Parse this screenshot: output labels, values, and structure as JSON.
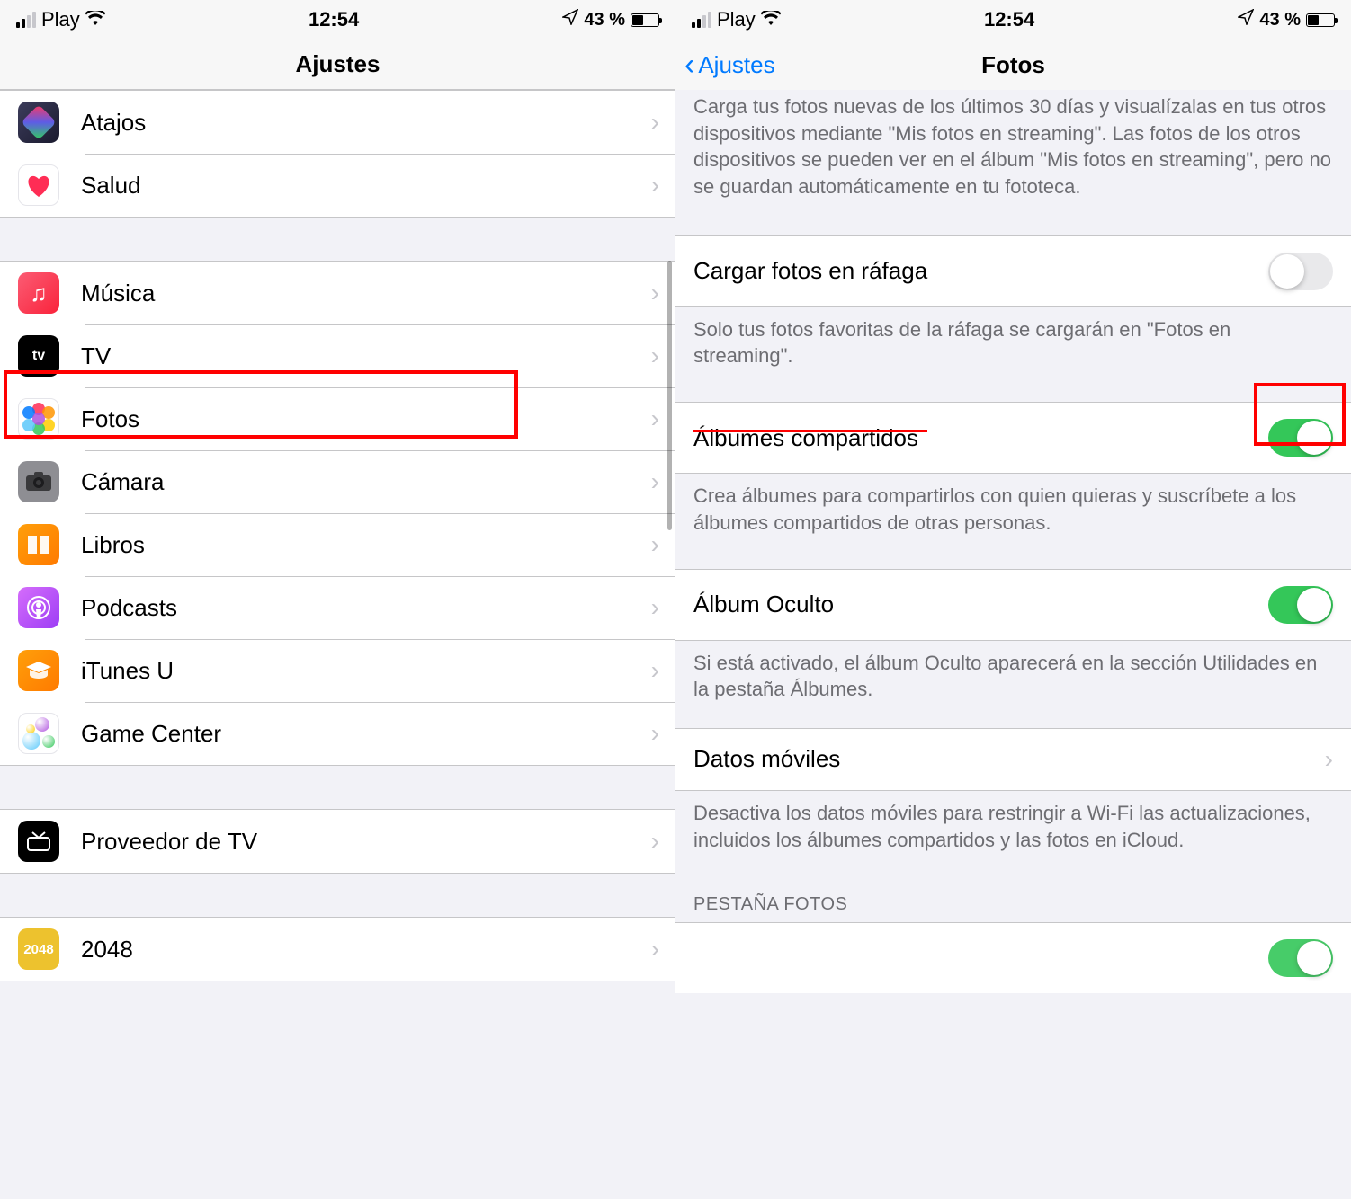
{
  "status": {
    "carrier": "Play",
    "time": "12:54",
    "battery": "43 %"
  },
  "left": {
    "title": "Ajustes",
    "sections": [
      {
        "items": [
          {
            "label": "Atajos",
            "icon": "atajos"
          },
          {
            "label": "Salud",
            "icon": "salud"
          }
        ]
      },
      {
        "items": [
          {
            "label": "Música",
            "icon": "musica"
          },
          {
            "label": "TV",
            "icon": "tv"
          },
          {
            "label": "Fotos",
            "icon": "fotos",
            "highlighted": true
          },
          {
            "label": "Cámara",
            "icon": "camara"
          },
          {
            "label": "Libros",
            "icon": "libros"
          },
          {
            "label": "Podcasts",
            "icon": "podcasts"
          },
          {
            "label": "iTunes U",
            "icon": "itunesu"
          },
          {
            "label": "Game Center",
            "icon": "gamecenter"
          }
        ]
      },
      {
        "items": [
          {
            "label": "Proveedor de TV",
            "icon": "tvprovider"
          }
        ]
      },
      {
        "items": [
          {
            "label": "2048",
            "icon": "2048"
          }
        ]
      }
    ]
  },
  "right": {
    "back": "Ajustes",
    "title": "Fotos",
    "top_desc": "Carga tus fotos nuevas de los últimos 30 días y visualízalas en tus otros dispositivos mediante \"Mis fotos en streaming\". Las fotos de los otros dispositivos se pueden ver en el álbum \"Mis fotos en streaming\", pero no se guardan automáticamente en tu fototeca.",
    "burst_label": "Cargar fotos en ráfaga",
    "burst_on": false,
    "burst_desc": "Solo tus fotos favoritas de la ráfaga se cargarán en \"Fotos en streaming\".",
    "shared_label": "Álbumes compartidos",
    "shared_on": true,
    "shared_desc": "Crea álbumes para compartirlos con quien quieras y suscríbete a los álbumes compartidos de otras personas.",
    "hidden_label": "Álbum Oculto",
    "hidden_on": true,
    "hidden_desc": "Si está activado, el álbum Oculto aparecerá en la sección Utilidades en la pestaña Álbumes.",
    "cellular_label": "Datos móviles",
    "cellular_desc": "Desactiva los datos móviles para restringir a Wi-Fi las actualizaciones, incluidos los álbumes compartidos y las fotos en iCloud.",
    "section_header": "PESTAÑA FOTOS"
  }
}
